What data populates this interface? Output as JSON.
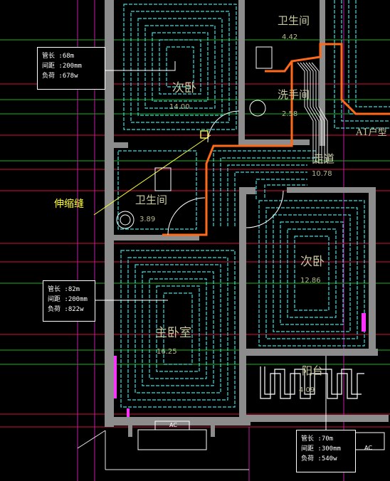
{
  "colors": {
    "background": "#000000",
    "wall": "#8a8a8a",
    "heating_pipe": "#33e6e6",
    "supply_pipe": "#ff6a1a",
    "axis_line": "#e0103a",
    "guide_line": "#00c800",
    "magenta": "#ff33ff",
    "callout": "#ffff33"
  },
  "rooms": [
    {
      "id": "bedroom_top",
      "name": "次卧",
      "area": "14.00"
    },
    {
      "id": "bath_top",
      "name": "卫生间",
      "area": "4.42"
    },
    {
      "id": "washroom",
      "name": "洗手间",
      "area": "2.58"
    },
    {
      "id": "corridor",
      "name": "走道",
      "area": "10.78"
    },
    {
      "id": "bath_mid",
      "name": "卫生间",
      "area": "3.89"
    },
    {
      "id": "bedroom_right",
      "name": "次卧",
      "area": "12.86"
    },
    {
      "id": "master",
      "name": "主卧室",
      "area": "16.25"
    },
    {
      "id": "balcony",
      "name": "阳台",
      "area": "4.09"
    }
  ],
  "unit_label": "A1户型",
  "expansion_joint_label": "伸缩缝",
  "annotations": [
    {
      "id": "a1",
      "lines": [
        "管长 :68m",
        "间距 :200mm",
        "负荷 :678w"
      ]
    },
    {
      "id": "a2",
      "lines": [
        "管长 :82m",
        "间距 :200mm",
        "负荷 :822w"
      ]
    },
    {
      "id": "a3",
      "lines": [
        "管长 :70m",
        "间距 :300mm",
        "负荷 :540w"
      ]
    }
  ],
  "equipment_labels": {
    "ac_left": "AC",
    "ac_right": "AC"
  }
}
